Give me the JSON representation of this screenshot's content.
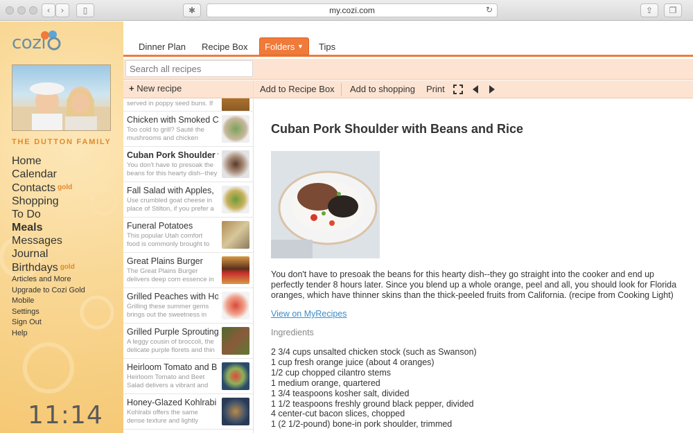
{
  "browser": {
    "url": "my.cozi.com"
  },
  "sidebar": {
    "logo": "cozi",
    "family_name": "THE DUTTON FAMILY",
    "nav_main": [
      {
        "label": "Home",
        "badge": ""
      },
      {
        "label": "Calendar",
        "badge": ""
      },
      {
        "label": "Contacts",
        "badge": "gold"
      },
      {
        "label": "Shopping",
        "badge": ""
      },
      {
        "label": "To Do",
        "badge": ""
      },
      {
        "label": "Meals",
        "badge": ""
      },
      {
        "label": "Messages",
        "badge": ""
      },
      {
        "label": "Journal",
        "badge": ""
      },
      {
        "label": "Birthdays",
        "badge": "gold"
      }
    ],
    "nav_secondary": [
      "Articles and More",
      "Upgrade to Cozi Gold",
      "Mobile",
      "Settings",
      "Sign Out",
      "Help"
    ],
    "clock": "11:14"
  },
  "tabs": [
    "Dinner Plan",
    "Recipe Box",
    "Folders",
    "Tips"
  ],
  "search": {
    "placeholder": "Search all recipes"
  },
  "new_recipe": "New recipe",
  "recipes": [
    {
      "title": "",
      "desc1": "served in poppy seed buns. If",
      "desc2": ""
    },
    {
      "title": "Chicken with Smoked C",
      "desc1": "Too cold to grill? Sauté the",
      "desc2": "mushrooms and chicken"
    },
    {
      "title": "Cuban Pork Shoulder w",
      "desc1": "You don't have to presoak the",
      "desc2": "beans for this hearty dish--they"
    },
    {
      "title": "Fall Salad with Apples,",
      "desc1": "Use crumbled goat cheese in",
      "desc2": "place of Stilton, if you prefer a"
    },
    {
      "title": "Funeral Potatoes",
      "desc1": "This popular Utah comfort",
      "desc2": "food is commonly brought to"
    },
    {
      "title": "Great Plains Burger",
      "desc1": "The Great Plains Burger",
      "desc2": "delivers deep corn essence in"
    },
    {
      "title": "Grilled Peaches with Ho",
      "desc1": "Grilling these summer gems",
      "desc2": "brings out the sweetness in"
    },
    {
      "title": "Grilled Purple Sprouting",
      "desc1": "A leggy cousin of broccoli, the",
      "desc2": "delicate purple florets and thin"
    },
    {
      "title": "Heirloom Tomato and B",
      "desc1": "Heirloom Tomato and Beet",
      "desc2": "Salad delivers a vibrant and"
    },
    {
      "title": "Honey-Glazed Kohlrabi",
      "desc1": "Kohlrabi offers the same",
      "desc2": "dense texture and lightly"
    }
  ],
  "toolbar": {
    "add_recipe_box": "Add to Recipe Box",
    "add_shopping": "Add to shopping",
    "print": "Print"
  },
  "detail": {
    "title": "Cuban Pork Shoulder with Beans and Rice",
    "description": "You don't have to presoak the beans for this hearty dish--they go straight into the cooker and end up perfectly tender 8 hours later. Since you blend up a whole orange, peel and all, you should look for Florida oranges, which have thinner skins than the thick-peeled fruits from California. (recipe from Cooking Light)",
    "link": "View on MyRecipes",
    "ingredients_heading": "Ingredients",
    "ingredients": [
      "2 3/4 cups unsalted chicken stock (such as Swanson)",
      "1 cup fresh orange juice (about 4 oranges)",
      "1/2 cup chopped cilantro stems",
      "1 medium orange, quartered",
      "1 3/4 teaspoons kosher salt, divided",
      "1 1/2 teaspoons freshly ground black pepper, divided",
      "4 center-cut bacon slices, chopped",
      "1 (2 1/2-pound) bone-in pork shoulder, trimmed"
    ]
  }
}
